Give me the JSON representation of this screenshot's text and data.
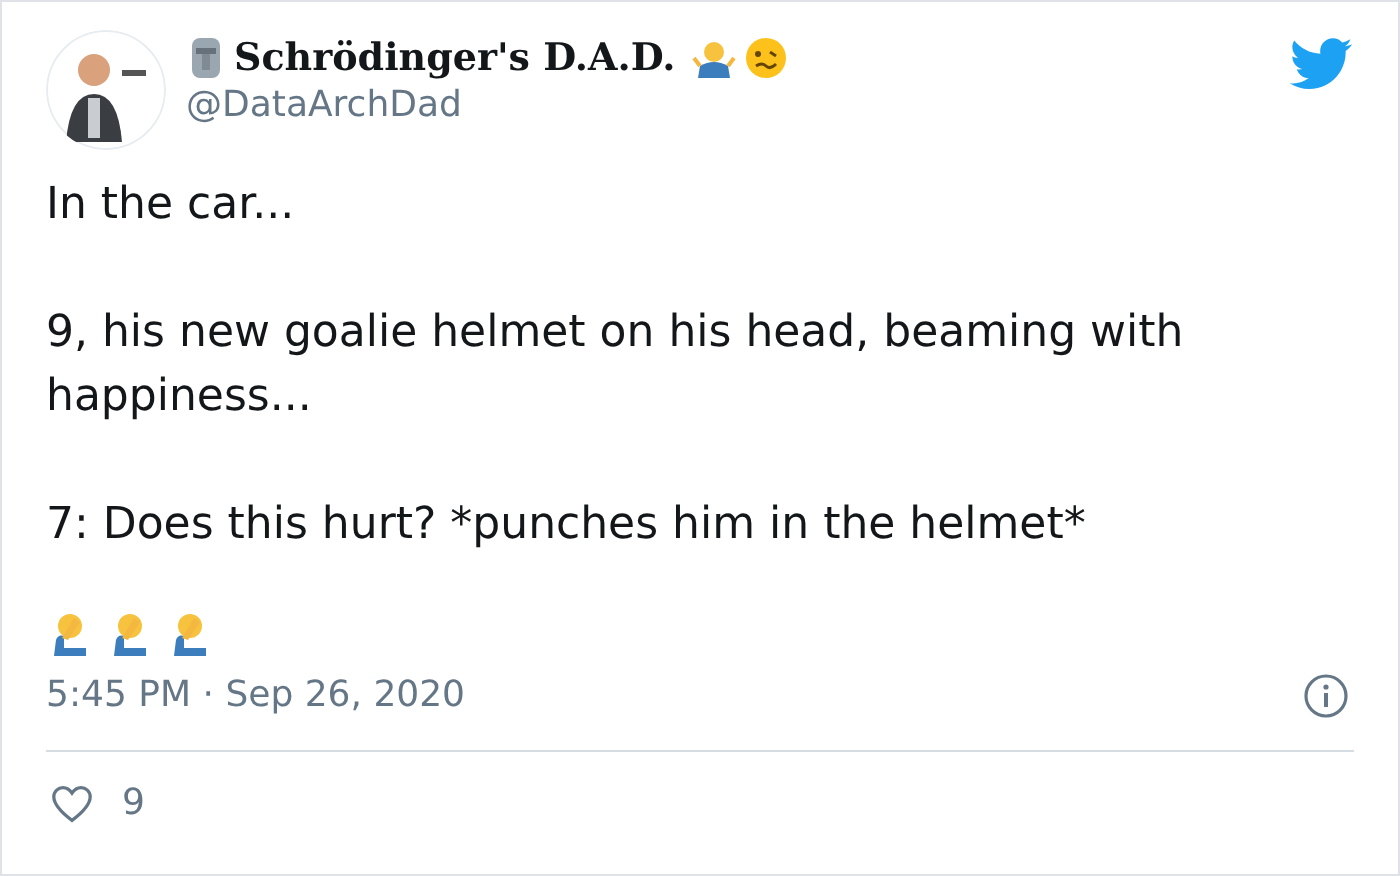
{
  "author": {
    "name": "Schrödinger's D.A.D.",
    "handle": "@DataArchDad"
  },
  "paragraphs": [
    "In the car...",
    "9, his new goalie helmet on his head, beaming with happiness...",
    "7: Does this hurt? *punches him in the helmet*"
  ],
  "timestamp": "5:45 PM · Sep 26, 2020",
  "likes": {
    "count": "9"
  }
}
